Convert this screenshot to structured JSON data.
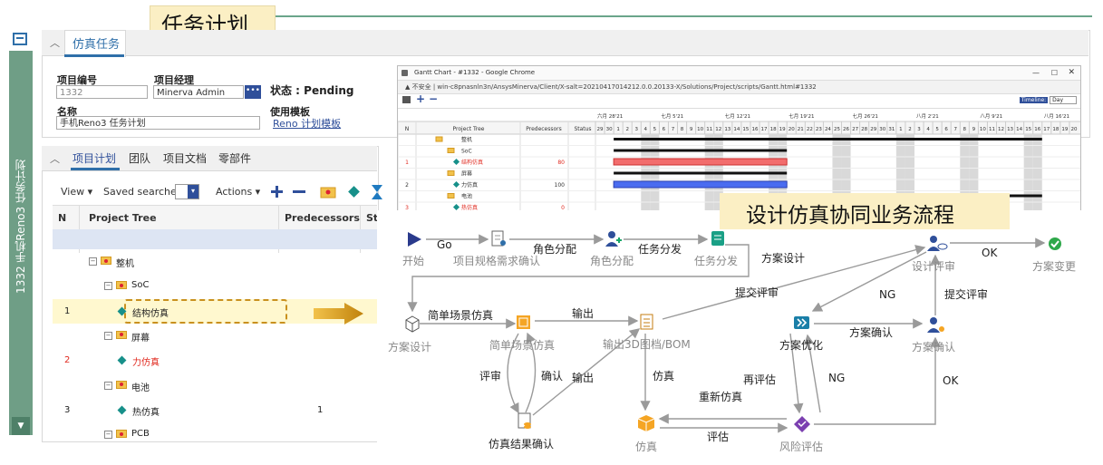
{
  "page_title": "任务计划",
  "sidebar": {
    "label": "1332 手机Reno3 任务计划"
  },
  "header_panel": {
    "tab_label": "仿真任务",
    "fields": {
      "project_no_label": "项目编号",
      "project_no_value": "1332",
      "manager_label": "项目经理",
      "manager_value": "Minerva Admin",
      "dots_label": "•••",
      "status_text": "状态 : Pending",
      "name_label": "名称",
      "name_value": "手机Reno3 任务计划",
      "template_label": "使用模板",
      "template_link": "Reno 计划模板"
    }
  },
  "plan_panel": {
    "tabs": [
      "项目计划",
      "团队",
      "项目文档",
      "零部件"
    ],
    "toolbar": {
      "view": "View",
      "saved_searches": "Saved searches:",
      "actions": "Actions"
    },
    "columns": [
      "N",
      "Project Tree",
      "Predecessors",
      "St"
    ],
    "rows": [
      {
        "n": "",
        "name": "整机",
        "pred": "",
        "indent": 0,
        "type": "folder"
      },
      {
        "n": "",
        "name": "SoC",
        "pred": "",
        "indent": 1,
        "type": "folder"
      },
      {
        "n": "1",
        "name": "结构仿真",
        "pred": "",
        "indent": 2,
        "type": "task"
      },
      {
        "n": "",
        "name": "屏幕",
        "pred": "",
        "indent": 1,
        "type": "folder"
      },
      {
        "n": "2",
        "name": "力仿真",
        "pred": "",
        "indent": 2,
        "type": "task",
        "red": true
      },
      {
        "n": "",
        "name": "电池",
        "pred": "",
        "indent": 1,
        "type": "folder"
      },
      {
        "n": "3",
        "name": "热仿真",
        "pred": "1",
        "indent": 2,
        "type": "task"
      },
      {
        "n": "",
        "name": "PCB",
        "pred": "",
        "indent": 1,
        "type": "folder"
      }
    ]
  },
  "gantt": {
    "window_title": "Gantt Chart - #1332 - Google Chrome",
    "address": "不安全 | win-c8pnasnln3n/AnsysMinerva/Client/X-salt=20210417014212.0.0.20133-X/Solutions/Project/scripts/Gantt.html#1332",
    "timeline_label": "Timeline:",
    "timeline_value": "Day",
    "columns": [
      "N",
      "Project Tree",
      "Predecessors",
      "Status"
    ],
    "month_labels": [
      "六月 28'21",
      "七月 5'21",
      "七月 12'21",
      "七月 19'21",
      "七月 26'21",
      "八月 2'21",
      "八月 9'21",
      "八月 16'21"
    ],
    "day_labels": [
      "29",
      "30",
      "1",
      "2",
      "3",
      "4",
      "5",
      "6",
      "7",
      "8",
      "9",
      "10",
      "11",
      "12",
      "13",
      "14",
      "15",
      "16",
      "17",
      "18",
      "19",
      "20",
      "21",
      "22",
      "23",
      "24",
      "25",
      "26",
      "27",
      "28",
      "29",
      "30",
      "31",
      "1",
      "2",
      "3",
      "4",
      "5",
      "6",
      "7",
      "8",
      "9",
      "10",
      "11",
      "12",
      "13",
      "14",
      "15",
      "16",
      "17",
      "18",
      "19",
      "20"
    ],
    "rows": [
      {
        "n": "",
        "name": "整机",
        "status": ""
      },
      {
        "n": "",
        "name": "SoC",
        "status": ""
      },
      {
        "n": "1",
        "name": "结构仿真",
        "status": "80",
        "red": true
      },
      {
        "n": "",
        "name": "屏幕",
        "status": ""
      },
      {
        "n": "2",
        "name": "力仿真",
        "status": "100"
      },
      {
        "n": "",
        "name": "电池",
        "status": ""
      },
      {
        "n": "3",
        "name": "热仿真",
        "status": "0",
        "red": true
      }
    ]
  },
  "flow": {
    "title": "设计仿真协同业务流程",
    "nodes": {
      "start": "开始",
      "req_confirm": "项目规格需求确认",
      "role_assign": "角色分配",
      "task_dispatch": "任务分发",
      "design_review": "设计评审",
      "scheme_change": "方案变更",
      "scheme_design": "方案设计",
      "simple_sim": "简单场景仿真",
      "output_3d": "输出3D图档/BOM",
      "scheme_opt": "方案优化",
      "scheme_confirm": "方案确认",
      "sim_result_confirm": "仿真结果确认",
      "simulation": "仿真",
      "risk_eval": "风险评估"
    },
    "edges": {
      "go": "Go",
      "role_assign": "角色分配",
      "task_dispatch": "任务分发",
      "scheme_design": "方案设计",
      "ok1": "OK",
      "submit_review1": "提交评审",
      "ng1": "NG",
      "submit_review2": "提交评审",
      "simple_sim": "简单场景仿真",
      "output1": "输出",
      "scheme_confirm": "方案确认",
      "review": "评审",
      "confirm": "确认",
      "output2": "输出",
      "simulate": "仿真",
      "re_eval": "再评估",
      "ng2": "NG",
      "ok2": "OK",
      "re_sim": "重新仿真",
      "evaluate": "评估"
    }
  }
}
